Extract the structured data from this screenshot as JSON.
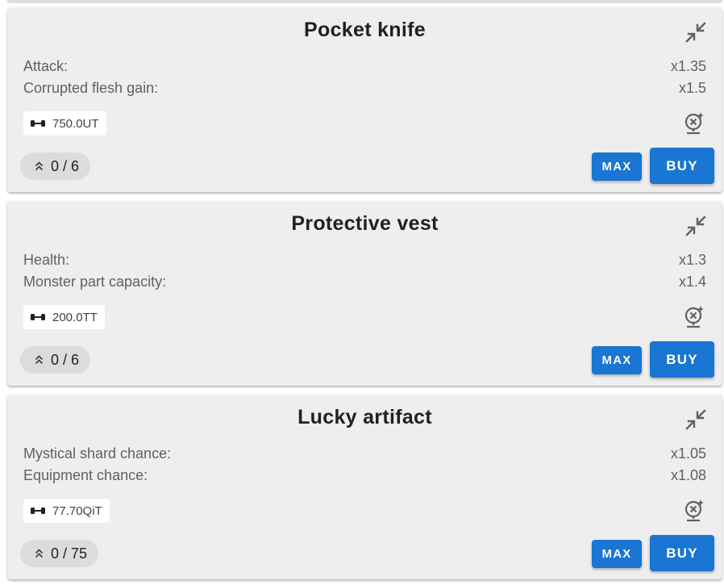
{
  "items": [
    {
      "title": "Pocket knife",
      "stats": [
        {
          "label": "Attack:",
          "value": "x1.35"
        },
        {
          "label": "Corrupted flesh gain:",
          "value": "x1.5"
        }
      ],
      "price": "750.0UT",
      "level": "0 / 6",
      "max_label": "MAX",
      "buy_label": "BUY"
    },
    {
      "title": "Protective vest",
      "stats": [
        {
          "label": "Health:",
          "value": "x1.3"
        },
        {
          "label": "Monster part capacity:",
          "value": "x1.4"
        }
      ],
      "price": "200.0TT",
      "level": "0 / 6",
      "max_label": "MAX",
      "buy_label": "BUY"
    },
    {
      "title": "Lucky artifact",
      "stats": [
        {
          "label": "Mystical shard chance:",
          "value": "x1.05"
        },
        {
          "label": "Equipment chance:",
          "value": "x1.08"
        }
      ],
      "price": "77.70QiT",
      "level": "0 / 75",
      "max_label": "MAX",
      "buy_label": "BUY"
    }
  ],
  "icons": {
    "collapse": "collapse-arrows-icon",
    "price": "dumbbell-icon",
    "auto_buy": "robot-autobuy-icon",
    "level": "chevron-double-up-icon"
  },
  "colors": {
    "card_bg": "#eeeeee",
    "button": "#1976d2",
    "level_chip_bg": "#dcdcdc",
    "text_secondary": "#616161"
  }
}
